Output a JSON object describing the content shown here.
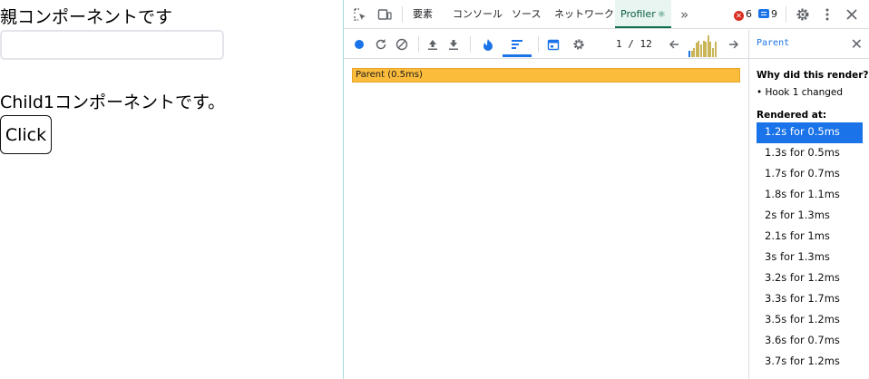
{
  "app": {
    "parent_heading": "親コンポーネントです",
    "input_value": "",
    "input_placeholder": "",
    "child_text": "Child1コンポーネントです。",
    "button_label": "Click"
  },
  "devtools": {
    "tabs": [
      {
        "label": "要素"
      },
      {
        "label": "コンソール"
      },
      {
        "label": "ソース"
      },
      {
        "label": "ネットワーク"
      },
      {
        "label": "Profiler",
        "active": true
      }
    ],
    "react_mark": "⚛",
    "more_tabs": "»",
    "error_count": "6",
    "message_count": "9",
    "profiler": {
      "commit_current": "1",
      "commit_separator": "/",
      "commit_total": "12",
      "flame_bar_label": "Parent (0.5ms)",
      "commit_durations_ms": [
        0.5,
        0.5,
        0.7,
        1.1,
        1.3,
        1.0,
        1.3,
        1.2,
        1.7,
        1.2,
        0.7,
        1.2
      ]
    },
    "sidebar": {
      "component_name": "Parent",
      "why_title": "Why did this render?",
      "why_reason": "• Hook 1 changed",
      "rendered_at_title": "Rendered at:",
      "renders": [
        {
          "label": "1.2s for 0.5ms",
          "selected": true
        },
        {
          "label": "1.3s for 0.5ms"
        },
        {
          "label": "1.7s for 0.7ms"
        },
        {
          "label": "1.8s for 1.1ms"
        },
        {
          "label": "2s for 1.3ms"
        },
        {
          "label": "2.1s for 1ms"
        },
        {
          "label": "3s for 1.3ms"
        },
        {
          "label": "3.2s for 1.2ms"
        },
        {
          "label": "3.3s for 1.7ms"
        },
        {
          "label": "3.5s for 1.2ms"
        },
        {
          "label": "3.6s for 0.7ms"
        },
        {
          "label": "3.7s for 1.2ms"
        }
      ]
    },
    "colors": {
      "accent_blue": "#1a73e8",
      "flame_yellow": "#fbbc3c",
      "profiler_tab_green": "#0b6e4f",
      "error_red": "#d93025"
    },
    "icons": [
      "inspect-element-icon",
      "device-toolbar-icon",
      "settings-gear-icon",
      "kebab-menu-icon",
      "close-icon",
      "record-icon",
      "reload-icon",
      "clear-icon",
      "load-profile-icon",
      "save-profile-icon",
      "flamegraph-icon",
      "ranked-chart-icon",
      "timeline-icon",
      "profiler-settings-icon",
      "arrow-left-icon",
      "arrow-right-icon"
    ]
  }
}
